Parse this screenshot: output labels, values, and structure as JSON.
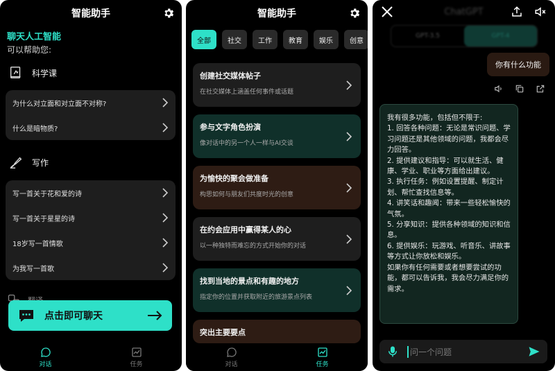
{
  "colors": {
    "accent": "#2ee0c8",
    "background": "#000000",
    "card": "#1e1e1e"
  },
  "screen1": {
    "title": "智能助手",
    "greeting_name": "聊天人工智能",
    "greeting_sub": "可以帮助您:",
    "sections": [
      {
        "heading": "科学课",
        "icon": "science-book-icon",
        "items": [
          "为什么对立面和对立面不对称?",
          "什么是暗物质?"
        ]
      },
      {
        "heading": "写作",
        "icon": "writing-hand-icon",
        "items": [
          "写一首关于花和爱的诗",
          "写一首关于星星的诗",
          "18岁写一首情歌",
          "为我写一首歌"
        ]
      }
    ],
    "partial_section": "翻译",
    "cta_label": "点击即可聊天",
    "nav": [
      {
        "label": "对话",
        "active": true
      },
      {
        "label": "任务",
        "active": false
      }
    ]
  },
  "screen2": {
    "title": "智能助手",
    "chips": [
      "全部",
      "社交",
      "工作",
      "教育",
      "娱乐",
      "创意"
    ],
    "tasks": [
      {
        "title": "创建社交媒体帖子",
        "subtitle": "在社交媒体上涵盖任何事件或话题",
        "color": "#1e1e1e"
      },
      {
        "title": "参与文字角色扮演",
        "subtitle": "像对话中的另一个人一样与AI交谈",
        "color": "#10302a"
      },
      {
        "title": "为愉快的聚会做准备",
        "subtitle": "构思如何与朋友们共度时光的创意",
        "color": "#2e1c14"
      },
      {
        "title": "在约会应用中赢得某人的心",
        "subtitle": "以一种独特而难忘的方式开始你的对话",
        "color": "#1e1e1e"
      },
      {
        "title": "找到当地的景点和有趣的地方",
        "subtitle": "指定你的位置并获取附近的旅游景点列表",
        "color": "#10302a"
      },
      {
        "title": "突出主要要点",
        "subtitle": "",
        "color": "#2e1c14"
      }
    ],
    "nav": [
      {
        "label": "对话",
        "active": false
      },
      {
        "label": "任务",
        "active": true
      }
    ]
  },
  "screen3": {
    "brand": "ChatGPT",
    "models": [
      "GPT-3.5",
      "GPT-4"
    ],
    "user_message": "你有什么功能",
    "assistant_lines": [
      "我有很多功能，包括但不限于:",
      "1. 回答各种问题：无论是常识问题、学习问题还是其他领域的问题，我都会尽力回答。",
      "2. 提供建议和指导：可以就生活、健康、学业、职业等方面给出建议。",
      "3. 执行任务：例如设置提醒、制定计划、帮忙查找信息等。",
      "4. 讲笑话和趣闻：带来一些轻松愉快的气氛。",
      "5. 分享知识：提供各种领域的知识和信息。",
      "6. 提供娱乐：玩游戏、听音乐、讲故事等方式让你放松和娱乐。",
      "如果你有任何需要或者想要尝试的功能，都可以告诉我，我会尽力满足你的需求。"
    ],
    "input_placeholder": "问一个问题"
  }
}
